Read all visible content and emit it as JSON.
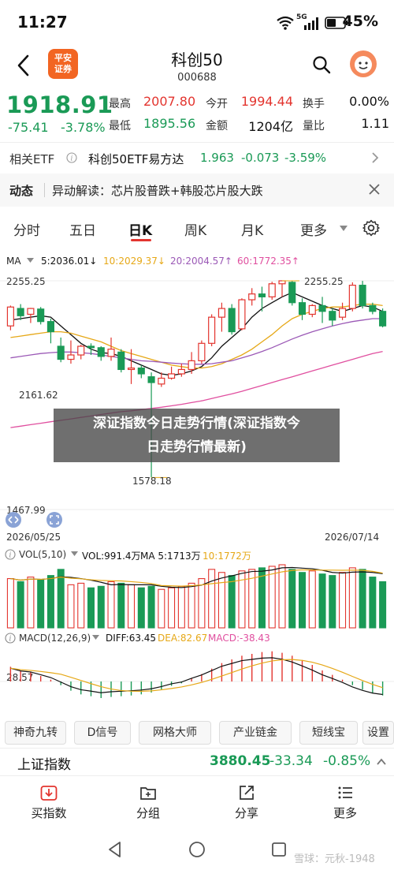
{
  "status": {
    "time": "11:27",
    "battery": "45%",
    "network": "5G"
  },
  "header": {
    "logo_top": "平安",
    "logo_bottom": "证券",
    "title": "科创50",
    "code": "000688"
  },
  "quote": {
    "price": "1918.91",
    "change": "-75.41",
    "change_pct": "-3.78%",
    "labels": {
      "high": "最高",
      "low": "最低",
      "open": "今开",
      "amount": "金额",
      "turnover": "换手",
      "volume_ratio": "量比"
    },
    "high": "2007.80",
    "low": "1895.56",
    "open": "1994.44",
    "amount": "1204亿",
    "turnover": "0.00%",
    "volume_ratio": "1.11"
  },
  "etf": {
    "label": "相关ETF",
    "name": "科创50ETF易方达",
    "price": "1.963",
    "change": "-0.073",
    "pct": "-3.59%"
  },
  "news": {
    "label": "动态",
    "text": "异动解读：芯片股普跌+韩股芯片股大跌"
  },
  "tabs": [
    "分时",
    "五日",
    "日K",
    "周K",
    "月K",
    "更多"
  ],
  "ma": {
    "label": "MA",
    "ma5": "5:2036.01↓",
    "ma10": "10:2029.37↓",
    "ma20": "20:2004.57↑",
    "ma60": "60:1772.35↑"
  },
  "chart_labels": {
    "top": "2255.25",
    "bottom": "1467.99",
    "high_mark": "2255.25",
    "low_mark": "1578.18",
    "mid_mark": "2161.62",
    "date_start": "2026/05/25",
    "date_end": "2026/07/14"
  },
  "vol": {
    "label": "VOL(5,10)",
    "vol": "VOL:991.4万",
    "ma5": "MA 5:1713万",
    "ma10": "10:1772万"
  },
  "macd": {
    "label": "MACD(12,26,9)",
    "diff": "DIFF:63.45",
    "dea": "DEA:82.67",
    "macd": "MACD:-38.43",
    "axis": "28.57"
  },
  "indicators": [
    "神奇九转",
    "D信号",
    "网格大师",
    "产业链金",
    "短线宝",
    "设置"
  ],
  "bottom_quote": {
    "name": "上证指数",
    "price": "3880.45",
    "change": "-33.34",
    "pct": "-0.85%"
  },
  "nav": [
    "买指数",
    "分组",
    "分享",
    "更多"
  ],
  "overlay": {
    "line1": "深证指数今日走势行情(深证指数今",
    "line2": "日走势行情最新)"
  },
  "watermark": "雪球：元秋-1948",
  "colors": {
    "up": "#e3352f",
    "down": "#1a9a56",
    "ma5": "#111111",
    "ma10": "#e6a817",
    "ma20": "#9b59b6",
    "ma60": "#e04f9f"
  },
  "chart_data": {
    "type": "candlestick",
    "title": "",
    "x_range": [
      "2026/05/25",
      "2026/07/14"
    ],
    "ylim": [
      1467.99,
      2255.25
    ],
    "candles": [
      {
        "o": 2100,
        "c": 2165,
        "h": 2170,
        "l": 2085
      },
      {
        "o": 2160,
        "c": 2135,
        "h": 2175,
        "l": 2120
      },
      {
        "o": 2140,
        "c": 2160,
        "h": 2162,
        "l": 2110
      },
      {
        "o": 2158,
        "c": 2115,
        "h": 2165,
        "l": 2105
      },
      {
        "o": 2115,
        "c": 2080,
        "h": 2125,
        "l": 2040
      },
      {
        "o": 2030,
        "c": 1985,
        "h": 2060,
        "l": 1975
      },
      {
        "o": 1985,
        "c": 2000,
        "h": 2050,
        "l": 1970
      },
      {
        "o": 2000,
        "c": 2030,
        "h": 2035,
        "l": 1985
      },
      {
        "o": 2030,
        "c": 2025,
        "h": 2040,
        "l": 2000
      },
      {
        "o": 2025,
        "c": 1995,
        "h": 2030,
        "l": 1980
      },
      {
        "o": 1995,
        "c": 2020,
        "h": 2060,
        "l": 1980
      },
      {
        "o": 2010,
        "c": 1950,
        "h": 2020,
        "l": 1940
      },
      {
        "o": 1950,
        "c": 1955,
        "h": 2020,
        "l": 1900
      },
      {
        "o": 1955,
        "c": 1935,
        "h": 1965,
        "l": 1920
      },
      {
        "o": 1925,
        "c": 1905,
        "h": 1940,
        "l": 1578.18
      },
      {
        "o": 1900,
        "c": 1920,
        "h": 1940,
        "l": 1890
      },
      {
        "o": 1920,
        "c": 1935,
        "h": 1960,
        "l": 1915
      },
      {
        "o": 1935,
        "c": 1950,
        "h": 1970,
        "l": 1925
      },
      {
        "o": 1950,
        "c": 1980,
        "h": 2010,
        "l": 1935
      },
      {
        "o": 1980,
        "c": 2040,
        "h": 2050,
        "l": 1970
      },
      {
        "o": 2040,
        "c": 2130,
        "h": 2140,
        "l": 2030
      },
      {
        "o": 2130,
        "c": 2160,
        "h": 2180,
        "l": 2080
      },
      {
        "o": 2160,
        "c": 2080,
        "h": 2175,
        "l": 2070
      },
      {
        "o": 2090,
        "c": 2190,
        "h": 2195,
        "l": 2085
      },
      {
        "o": 2190,
        "c": 2210,
        "h": 2230,
        "l": 2170
      },
      {
        "o": 2210,
        "c": 2200,
        "h": 2235,
        "l": 2150
      },
      {
        "o": 2200,
        "c": 2245,
        "h": 2252,
        "l": 2190
      },
      {
        "o": 2245,
        "c": 2255.25,
        "h": 2255.25,
        "l": 2200
      },
      {
        "o": 2250,
        "c": 2180,
        "h": 2255,
        "l": 2170
      },
      {
        "o": 2180,
        "c": 2140,
        "h": 2195,
        "l": 2120
      },
      {
        "o": 2140,
        "c": 2170,
        "h": 2175,
        "l": 2130
      },
      {
        "o": 2170,
        "c": 2150,
        "h": 2200,
        "l": 2110
      },
      {
        "o": 2150,
        "c": 2120,
        "h": 2160,
        "l": 2100
      },
      {
        "o": 2130,
        "c": 2160,
        "h": 2180,
        "l": 2120
      },
      {
        "o": 2160,
        "c": 2240,
        "h": 2250,
        "l": 2150
      },
      {
        "o": 2240,
        "c": 2170,
        "h": 2255,
        "l": 2160
      },
      {
        "o": 2170,
        "c": 2150,
        "h": 2180,
        "l": 2140
      },
      {
        "o": 2150,
        "c": 2100,
        "h": 2160,
        "l": 2095
      }
    ],
    "ma_lines": [
      {
        "name": "MA5",
        "values": [
          2120,
          2125,
          2130,
          2135,
          2130,
          2100,
          2070,
          2040,
          2020,
          2008,
          2005,
          1995,
          1980,
          1965,
          1950,
          1935,
          1930,
          1935,
          1945,
          1960,
          1990,
          2030,
          2060,
          2090,
          2130,
          2160,
          2180,
          2200,
          2215,
          2200,
          2185,
          2170,
          2160,
          2150,
          2160,
          2170,
          2165,
          2150
        ]
      },
      {
        "name": "MA10",
        "values": [
          2060,
          2065,
          2070,
          2075,
          2080,
          2080,
          2075,
          2065,
          2055,
          2045,
          2030,
          2015,
          2005,
          1995,
          1985,
          1975,
          1965,
          1960,
          1955,
          1955,
          1960,
          1970,
          1985,
          2000,
          2020,
          2045,
          2070,
          2100,
          2125,
          2140,
          2150,
          2160,
          2165,
          2165,
          2170,
          2175,
          2175,
          2170
        ]
      },
      {
        "name": "MA20",
        "values": [
          1990,
          1995,
          2000,
          2005,
          2008,
          2010,
          2010,
          2008,
          2005,
          2000,
          1995,
          1990,
          1985,
          1980,
          1978,
          1975,
          1972,
          1970,
          1968,
          1968,
          1970,
          1975,
          1980,
          1990,
          2000,
          2012,
          2025,
          2040,
          2055,
          2068,
          2080,
          2090,
          2100,
          2108,
          2115,
          2120,
          2125,
          2125
        ]
      },
      {
        "name": "MA60",
        "values": [
          1750,
          1755,
          1760,
          1765,
          1770,
          1775,
          1780,
          1785,
          1790,
          1795,
          1800,
          1805,
          1808,
          1812,
          1816,
          1820,
          1825,
          1830,
          1836,
          1842,
          1850,
          1858,
          1866,
          1875,
          1885,
          1895,
          1905,
          1915,
          1925,
          1935,
          1945,
          1955,
          1965,
          1975,
          1985,
          1995,
          2005,
          2012
        ]
      }
    ],
    "volume": [
      1600,
      1500,
      1650,
      1550,
      1700,
      1900,
      1400,
      1450,
      1300,
      1350,
      1500,
      1450,
      1400,
      1300,
      1350,
      1250,
      1300,
      1350,
      1450,
      1600,
      1900,
      1800,
      1700,
      1850,
      1900,
      1950,
      2000,
      2050,
      1900,
      1800,
      1850,
      1750,
      1700,
      1800,
      1950,
      1900,
      1650,
      1500
    ],
    "macd_hist": [
      40,
      30,
      25,
      15,
      5,
      -10,
      -25,
      -35,
      -40,
      -45,
      -42,
      -40,
      -38,
      -35,
      -30,
      -22,
      -12,
      -5,
      8,
      20,
      35,
      50,
      60,
      70,
      75,
      80,
      82,
      78,
      70,
      58,
      45,
      30,
      18,
      5,
      -10,
      -22,
      -32,
      -38
    ]
  }
}
